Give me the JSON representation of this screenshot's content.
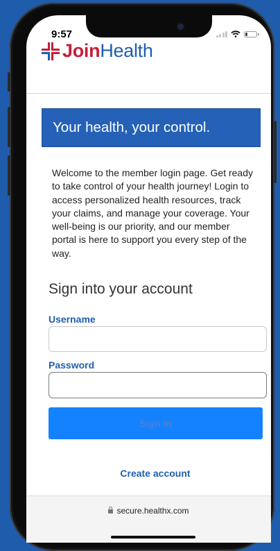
{
  "status": {
    "time": "9:57"
  },
  "brand": {
    "part1": "Join",
    "part2": "Health",
    "colors": {
      "red": "#c4203a",
      "blue": "#1f5fae"
    }
  },
  "hero": {
    "text": "Your health, your control."
  },
  "intro": {
    "text": "Welcome to the member login page. Get ready to take control of your health journey! Login to access personalized health resources, track your claims, and manage your coverage. Your well-being is our priority, and our member portal is here to support you every step of the way."
  },
  "form": {
    "title": "Sign into your account",
    "username_label": "Username",
    "username_value": "",
    "password_label": "Password",
    "password_value": "",
    "submit_label": "Sign in"
  },
  "links": {
    "create_account": "Create account"
  },
  "browser": {
    "url": "secure.healthx.com",
    "lock_icon": "lock-icon"
  }
}
